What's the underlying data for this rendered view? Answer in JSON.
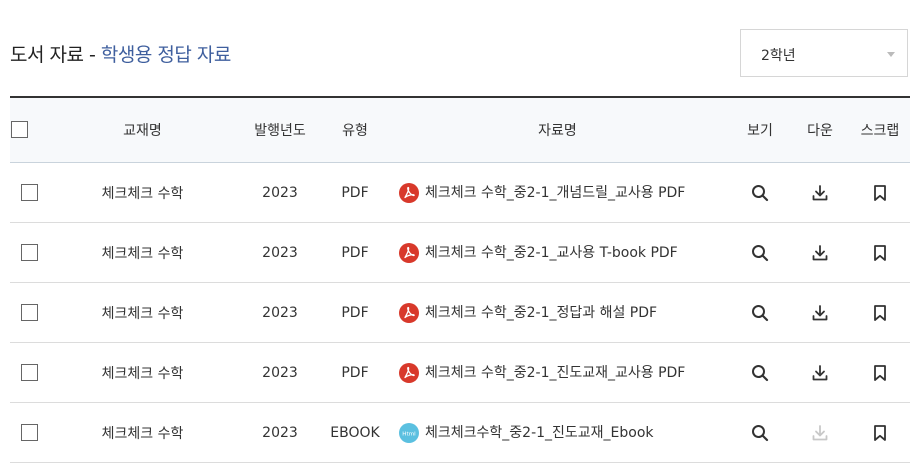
{
  "header": {
    "title_prefix": "도서 자료 - ",
    "title_accent": "학생용 정답 자료"
  },
  "grade_select": {
    "value": "2학년"
  },
  "table": {
    "columns": [
      "교재명",
      "발행년도",
      "유형",
      "자료명",
      "보기",
      "다운",
      "스크랩"
    ],
    "rows": [
      {
        "book": "체크체크 수학",
        "year": "2023",
        "type": "PDF",
        "file_icon": "pdf-icon",
        "name": "체크체크 수학_중2-1_개념드릴_교사용 PDF",
        "download_enabled": true
      },
      {
        "book": "체크체크 수학",
        "year": "2023",
        "type": "PDF",
        "file_icon": "pdf-icon",
        "name": "체크체크 수학_중2-1_교사용 T-book PDF",
        "download_enabled": true
      },
      {
        "book": "체크체크 수학",
        "year": "2023",
        "type": "PDF",
        "file_icon": "pdf-icon",
        "name": "체크체크 수학_중2-1_정답과 해설 PDF",
        "download_enabled": true
      },
      {
        "book": "체크체크 수학",
        "year": "2023",
        "type": "PDF",
        "file_icon": "pdf-icon",
        "name": "체크체크 수학_중2-1_진도교재_교사용 PDF",
        "download_enabled": true
      },
      {
        "book": "체크체크 수학",
        "year": "2023",
        "type": "EBOOK",
        "file_icon": "html-icon",
        "name": "체크체크수학_중2-1_진도교재_Ebook",
        "download_enabled": false
      }
    ]
  },
  "colors": {
    "accent": "#3f5f9e",
    "pdf": "#d8392b",
    "html": "#5bc0e0",
    "disabled": "#c8c8c8"
  }
}
